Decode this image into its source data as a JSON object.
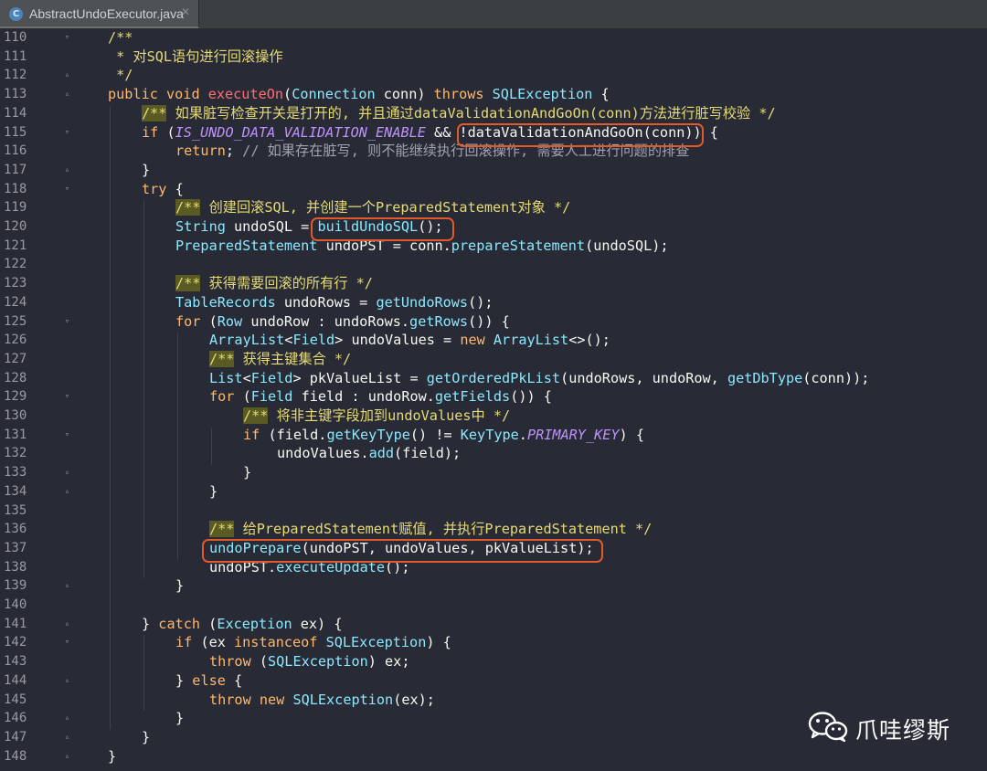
{
  "tab": {
    "title": "AbstractUndoExecutor.java",
    "close": "✕",
    "icon": "C"
  },
  "watermark": {
    "text": "爪哇缪斯",
    "icon": "wechat-logo"
  },
  "lines": [
    {
      "n": "110",
      "fold": "▿",
      "indent": 1,
      "segs": [
        [
          "cm",
          "/**"
        ]
      ]
    },
    {
      "n": "111",
      "fold": "",
      "indent": 1,
      "segs": [
        [
          "cm",
          " * 对SQL语句进行回滚操作"
        ]
      ]
    },
    {
      "n": "112",
      "fold": "▵",
      "indent": 1,
      "segs": [
        [
          "cm",
          " */"
        ]
      ]
    },
    {
      "n": "113",
      "fold": "▵",
      "indent": 1,
      "segs": [
        [
          "kw",
          "public "
        ],
        [
          "kw",
          "void "
        ],
        [
          "fn",
          "executeOn"
        ],
        [
          "",
          "("
        ],
        [
          "ty",
          "Connection"
        ],
        [
          "",
          " conn) "
        ],
        [
          "kw",
          "throws "
        ],
        [
          "ty",
          "SQLException"
        ],
        [
          "",
          " {"
        ]
      ]
    },
    {
      "n": "114",
      "fold": "",
      "indent": 2,
      "segs": [
        [
          "cmk",
          "/**"
        ],
        [
          "cm",
          " 如果脏写检查开关是打开的, 并且通过dataValidationAndGoOn(conn)方法进行脏写校验 */"
        ]
      ]
    },
    {
      "n": "115",
      "fold": "▿",
      "indent": 2,
      "segs": [
        [
          "kw",
          "if"
        ],
        [
          "",
          " ("
        ],
        [
          "it",
          "IS_UNDO_DATA_VALIDATION_ENABLE"
        ],
        [
          "",
          " && "
        ],
        [
          "",
          "!dataValidationAndGoOn(conn)"
        ],
        [
          "",
          ") {"
        ]
      ]
    },
    {
      "n": "116",
      "fold": "",
      "indent": 3,
      "segs": [
        [
          "kw",
          "return"
        ],
        [
          "",
          ";"
        ],
        [
          "gray",
          " // 如果存在脏写, 则不能继续执行回滚操作, 需要人工进行问题的排查"
        ]
      ]
    },
    {
      "n": "117",
      "fold": "▵",
      "indent": 2,
      "segs": [
        [
          "",
          "}"
        ]
      ]
    },
    {
      "n": "118",
      "fold": "▿",
      "indent": 2,
      "segs": [
        [
          "kw",
          "try"
        ],
        [
          "",
          " {"
        ]
      ]
    },
    {
      "n": "119",
      "fold": "",
      "indent": 3,
      "segs": [
        [
          "cmk",
          "/**"
        ],
        [
          "cm",
          " 创建回滚SQL, 并创建一个PreparedStatement对象 */"
        ]
      ]
    },
    {
      "n": "120",
      "fold": "",
      "indent": 3,
      "segs": [
        [
          "ty",
          "String"
        ],
        [
          "",
          " undoSQL = "
        ],
        [
          "mcall",
          "buildUndoSQL"
        ],
        [
          "",
          "();"
        ]
      ]
    },
    {
      "n": "121",
      "fold": "",
      "indent": 3,
      "segs": [
        [
          "ty",
          "PreparedStatement"
        ],
        [
          "",
          " undoPST = "
        ],
        [
          "",
          "conn."
        ],
        [
          "mcall",
          "prepareStatement"
        ],
        [
          "",
          "(undoSQL);"
        ]
      ]
    },
    {
      "n": "122",
      "fold": "",
      "indent": 3,
      "segs": []
    },
    {
      "n": "123",
      "fold": "",
      "indent": 3,
      "segs": [
        [
          "cmk",
          "/**"
        ],
        [
          "cm",
          " 获得需要回滚的所有行 */"
        ]
      ]
    },
    {
      "n": "124",
      "fold": "",
      "indent": 3,
      "segs": [
        [
          "ty",
          "TableRecords"
        ],
        [
          "",
          " undoRows = "
        ],
        [
          "mcall",
          "getUndoRows"
        ],
        [
          "",
          "();"
        ]
      ]
    },
    {
      "n": "125",
      "fold": "▿",
      "indent": 3,
      "segs": [
        [
          "kw",
          "for"
        ],
        [
          "",
          " ("
        ],
        [
          "ty",
          "Row"
        ],
        [
          "",
          " undoRow : undoRows."
        ],
        [
          "mcall",
          "getRows"
        ],
        [
          "",
          "()) {"
        ]
      ]
    },
    {
      "n": "126",
      "fold": "",
      "indent": 4,
      "segs": [
        [
          "ty",
          "ArrayList"
        ],
        [
          "",
          "<"
        ],
        [
          "ty",
          "Field"
        ],
        [
          "",
          "> undoValues = "
        ],
        [
          "kw",
          "new "
        ],
        [
          "ty",
          "ArrayList"
        ],
        [
          "",
          "<>();"
        ]
      ]
    },
    {
      "n": "127",
      "fold": "",
      "indent": 4,
      "segs": [
        [
          "cmk",
          "/**"
        ],
        [
          "cm",
          " 获得主键集合 */"
        ]
      ]
    },
    {
      "n": "128",
      "fold": "",
      "indent": 4,
      "segs": [
        [
          "ty",
          "List"
        ],
        [
          "",
          "<"
        ],
        [
          "ty",
          "Field"
        ],
        [
          "",
          "> pkValueList = "
        ],
        [
          "mcall",
          "getOrderedPkList"
        ],
        [
          "",
          "(undoRows, undoRow, "
        ],
        [
          "mcall",
          "getDbType"
        ],
        [
          "",
          "(conn));"
        ]
      ]
    },
    {
      "n": "129",
      "fold": "▿",
      "indent": 4,
      "segs": [
        [
          "kw",
          "for"
        ],
        [
          "",
          " ("
        ],
        [
          "ty",
          "Field"
        ],
        [
          "",
          " field : undoRow."
        ],
        [
          "mcall",
          "getFields"
        ],
        [
          "",
          "()) {"
        ]
      ]
    },
    {
      "n": "130",
      "fold": "",
      "indent": 5,
      "segs": [
        [
          "cmk",
          "/**"
        ],
        [
          "cm",
          " 将非主键字段加到undoValues中 */"
        ]
      ]
    },
    {
      "n": "131",
      "fold": "▿",
      "indent": 5,
      "segs": [
        [
          "kw",
          "if"
        ],
        [
          "",
          " (field."
        ],
        [
          "mcall",
          "getKeyType"
        ],
        [
          "",
          "() != "
        ],
        [
          "ty",
          "KeyType"
        ],
        [
          "",
          "."
        ],
        [
          "it",
          "PRIMARY_KEY"
        ],
        [
          "",
          ") {"
        ]
      ]
    },
    {
      "n": "132",
      "fold": "",
      "indent": 6,
      "segs": [
        [
          "",
          "undoValues."
        ],
        [
          "mcall",
          "add"
        ],
        [
          "",
          "(field);"
        ]
      ]
    },
    {
      "n": "133",
      "fold": "▵",
      "indent": 5,
      "segs": [
        [
          "",
          "}"
        ]
      ]
    },
    {
      "n": "134",
      "fold": "▵",
      "indent": 4,
      "segs": [
        [
          "",
          "}"
        ]
      ]
    },
    {
      "n": "135",
      "fold": "",
      "indent": 4,
      "segs": []
    },
    {
      "n": "136",
      "fold": "",
      "indent": 4,
      "segs": [
        [
          "cmk",
          "/**"
        ],
        [
          "cm",
          " 给PreparedStatement赋值, 并执行PreparedStatement */"
        ]
      ]
    },
    {
      "n": "137",
      "fold": "",
      "indent": 4,
      "segs": [
        [
          "mcall",
          "undoPrepare"
        ],
        [
          "",
          "(undoPST, undoValues, pkValueList);"
        ]
      ]
    },
    {
      "n": "138",
      "fold": "",
      "indent": 4,
      "segs": [
        [
          "",
          "undoPST."
        ],
        [
          "mcall",
          "executeUpdate"
        ],
        [
          "",
          "();"
        ]
      ]
    },
    {
      "n": "139",
      "fold": "▵",
      "indent": 3,
      "segs": [
        [
          "",
          "}"
        ]
      ]
    },
    {
      "n": "140",
      "fold": "",
      "indent": 2,
      "segs": []
    },
    {
      "n": "141",
      "fold": "▵",
      "indent": 2,
      "segs": [
        [
          "",
          "} "
        ],
        [
          "kw",
          "catch"
        ],
        [
          "",
          " ("
        ],
        [
          "ty",
          "Exception"
        ],
        [
          "",
          " ex) {"
        ]
      ]
    },
    {
      "n": "142",
      "fold": "▿",
      "indent": 3,
      "segs": [
        [
          "kw",
          "if"
        ],
        [
          "",
          " (ex "
        ],
        [
          "kw",
          "instanceof "
        ],
        [
          "ty",
          "SQLException"
        ],
        [
          "",
          ") {"
        ]
      ]
    },
    {
      "n": "143",
      "fold": "",
      "indent": 4,
      "segs": [
        [
          "kw",
          "throw"
        ],
        [
          "",
          " ("
        ],
        [
          "ty",
          "SQLException"
        ],
        [
          "",
          ") ex;"
        ]
      ]
    },
    {
      "n": "144",
      "fold": "▵",
      "indent": 3,
      "segs": [
        [
          "",
          "} "
        ],
        [
          "kw",
          "else"
        ],
        [
          "",
          " {"
        ]
      ]
    },
    {
      "n": "145",
      "fold": "",
      "indent": 4,
      "segs": [
        [
          "kw",
          "throw "
        ],
        [
          "kw",
          "new "
        ],
        [
          "ty",
          "SQLException"
        ],
        [
          "",
          "(ex);"
        ]
      ]
    },
    {
      "n": "146",
      "fold": "▵",
      "indent": 3,
      "segs": [
        [
          "",
          "}"
        ]
      ]
    },
    {
      "n": "147",
      "fold": "▵",
      "indent": 2,
      "segs": [
        [
          "",
          "}"
        ]
      ]
    },
    {
      "n": "148",
      "fold": "▵",
      "indent": 1,
      "segs": [
        [
          "",
          "}"
        ]
      ]
    }
  ]
}
